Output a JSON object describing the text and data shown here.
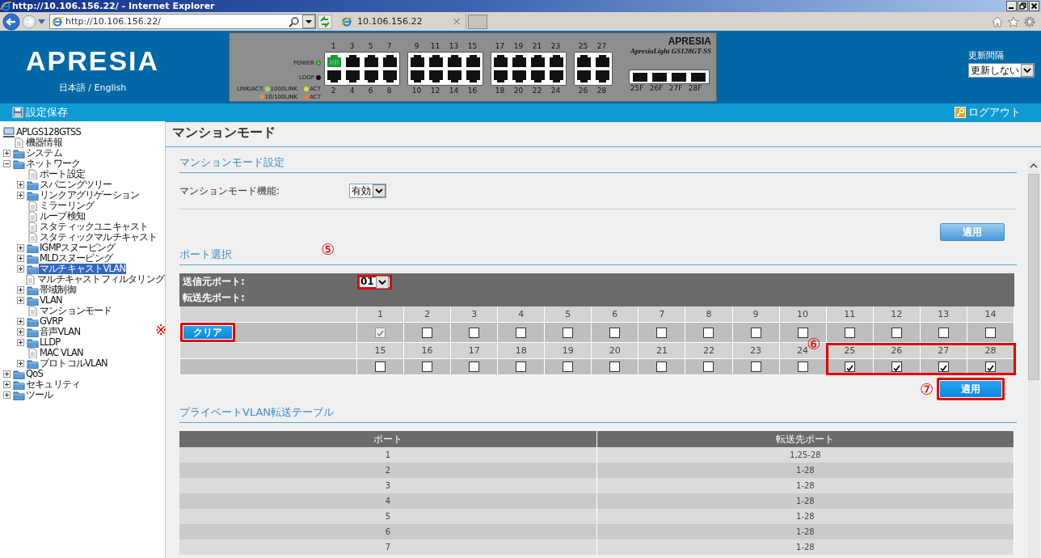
{
  "window": {
    "title": "http://10.106.156.22/ - Internet Explorer"
  },
  "browser": {
    "address": "http://10.106.156.22/",
    "tab": {
      "label": "10.106.156.22",
      "close": "×"
    }
  },
  "header": {
    "logo": "APRESIA",
    "language": "日本語 / English",
    "refresh": {
      "label": "更新間隔",
      "value": "更新しない"
    }
  },
  "switch_panel": {
    "brand": "APRESIA",
    "model": "ApresiaLight GS128GT-SS",
    "indicators": [
      {
        "label": "POWER",
        "on": true
      },
      {
        "label": "LOOP",
        "on": false
      }
    ],
    "legend_title": "LINK/ACT:",
    "legend": [
      {
        "label": "1000LINK",
        "color": "#9be25a"
      },
      {
        "label": "ACT",
        "color": "#c8e83c"
      },
      {
        "label": "10/100LINK",
        "color": "#f08a4a"
      },
      {
        "label": "ACT",
        "color": "#f07a3a"
      }
    ],
    "port_groups": [
      [
        {
          "top": {
            "label": "1",
            "link": true
          },
          "bottom": {
            "label": "2",
            "link": false
          }
        },
        {
          "top": {
            "label": "3",
            "link": false
          },
          "bottom": {
            "label": "4",
            "link": false
          }
        },
        {
          "top": {
            "label": "5",
            "link": false
          },
          "bottom": {
            "label": "6",
            "link": false
          }
        },
        {
          "top": {
            "label": "7",
            "link": false
          },
          "bottom": {
            "label": "8",
            "link": false
          }
        }
      ],
      [
        {
          "top": {
            "label": "9",
            "link": false
          },
          "bottom": {
            "label": "10",
            "link": false
          }
        },
        {
          "top": {
            "label": "11",
            "link": false
          },
          "bottom": {
            "label": "12",
            "link": false
          }
        },
        {
          "top": {
            "label": "13",
            "link": false
          },
          "bottom": {
            "label": "14",
            "link": false
          }
        },
        {
          "top": {
            "label": "15",
            "link": false
          },
          "bottom": {
            "label": "16",
            "link": false
          }
        }
      ],
      [
        {
          "top": {
            "label": "17",
            "link": false
          },
          "bottom": {
            "label": "18",
            "link": false
          }
        },
        {
          "top": {
            "label": "19",
            "link": false
          },
          "bottom": {
            "label": "20",
            "link": false
          }
        },
        {
          "top": {
            "label": "21",
            "link": false
          },
          "bottom": {
            "label": "22",
            "link": false
          }
        },
        {
          "top": {
            "label": "23",
            "link": false
          },
          "bottom": {
            "label": "24",
            "link": false
          }
        }
      ],
      [
        {
          "top": {
            "label": "25",
            "link": false
          },
          "bottom": {
            "label": "26",
            "link": false
          }
        },
        {
          "top": {
            "label": "27",
            "link": false
          },
          "bottom": {
            "label": "28",
            "link": false
          }
        }
      ]
    ],
    "sfp": [
      {
        "label": "25F"
      },
      {
        "label": "26F"
      },
      {
        "label": "27F"
      },
      {
        "label": "28F"
      }
    ]
  },
  "toolbar": {
    "save": "設定保存",
    "logout": "ログアウト"
  },
  "sidebar": {
    "root": {
      "label": "APLGS128GTSS",
      "kind": "device",
      "selected": false,
      "children": [
        {
          "label": "機器情報",
          "kind": "page",
          "selected": false
        },
        {
          "label": "システム",
          "kind": "folder",
          "expanded": false,
          "selected": false
        },
        {
          "label": "ネットワーク",
          "kind": "folder",
          "expanded": true,
          "selected": false,
          "children": [
            {
              "label": "ポート設定",
              "kind": "page",
              "selected": false
            },
            {
              "label": "スパニングツリー",
              "kind": "folder",
              "expanded": false,
              "selected": false
            },
            {
              "label": "リンクアグリゲーション",
              "kind": "folder",
              "expanded": false,
              "selected": false
            },
            {
              "label": "ミラーリング",
              "kind": "page",
              "selected": false
            },
            {
              "label": "ループ検知",
              "kind": "page",
              "selected": false
            },
            {
              "label": "スタティックユニキャスト",
              "kind": "page",
              "selected": false
            },
            {
              "label": "スタティックマルチキャスト",
              "kind": "page",
              "selected": false
            },
            {
              "label": "IGMPスヌーピング",
              "kind": "folder",
              "expanded": false,
              "selected": false
            },
            {
              "label": "MLDスヌーピング",
              "kind": "folder",
              "expanded": false,
              "selected": false
            },
            {
              "label": "マルチキャストVLAN",
              "kind": "folder",
              "expanded": false,
              "selected": true
            },
            {
              "label": "マルチキャストフィルタリング",
              "kind": "page",
              "selected": false
            },
            {
              "label": "帯域制御",
              "kind": "folder",
              "expanded": false,
              "selected": false
            },
            {
              "label": "VLAN",
              "kind": "folder",
              "expanded": false,
              "selected": false
            },
            {
              "label": "マンションモード",
              "kind": "page",
              "selected": false
            },
            {
              "label": "GVRP",
              "kind": "folder",
              "expanded": false,
              "selected": false
            },
            {
              "label": "音声VLAN",
              "kind": "folder",
              "expanded": false,
              "selected": false
            },
            {
              "label": "LLDP",
              "kind": "folder",
              "expanded": false,
              "selected": false
            },
            {
              "label": "MAC VLAN",
              "kind": "page",
              "selected": false
            },
            {
              "label": "プロトコルVLAN",
              "kind": "folder",
              "expanded": false,
              "selected": false
            }
          ]
        },
        {
          "label": "QoS",
          "kind": "folder",
          "expanded": false,
          "selected": false
        },
        {
          "label": "セキュリティ",
          "kind": "folder",
          "expanded": false,
          "selected": false
        },
        {
          "label": "ツール",
          "kind": "folder",
          "expanded": false,
          "selected": false
        }
      ]
    }
  },
  "main": {
    "title": "マンションモード",
    "mansion_settings": {
      "heading": "マンションモード設定",
      "field_label": "マンションモード機能:",
      "value": "有効",
      "apply": "適用"
    },
    "port_select": {
      "heading": "ポート選択",
      "source_label": "送信元ポート:",
      "source_value": "01",
      "source_highlighted": true,
      "dest_label": "転送先ポート:",
      "clear": {
        "label": "クリア",
        "highlighted": true
      },
      "ports": [
        {
          "label": "1",
          "checked": true,
          "disabled": true,
          "highlighted": false
        },
        {
          "label": "2",
          "checked": false,
          "disabled": false,
          "highlighted": false
        },
        {
          "label": "3",
          "checked": false,
          "disabled": false,
          "highlighted": false
        },
        {
          "label": "4",
          "checked": false,
          "disabled": false,
          "highlighted": false
        },
        {
          "label": "5",
          "checked": false,
          "disabled": false,
          "highlighted": false
        },
        {
          "label": "6",
          "checked": false,
          "disabled": false,
          "highlighted": false
        },
        {
          "label": "7",
          "checked": false,
          "disabled": false,
          "highlighted": false
        },
        {
          "label": "8",
          "checked": false,
          "disabled": false,
          "highlighted": false
        },
        {
          "label": "9",
          "checked": false,
          "disabled": false,
          "highlighted": false
        },
        {
          "label": "10",
          "checked": false,
          "disabled": false,
          "highlighted": false
        },
        {
          "label": "11",
          "checked": false,
          "disabled": false,
          "highlighted": false
        },
        {
          "label": "12",
          "checked": false,
          "disabled": false,
          "highlighted": false
        },
        {
          "label": "13",
          "checked": false,
          "disabled": false,
          "highlighted": false
        },
        {
          "label": "14",
          "checked": false,
          "disabled": false,
          "highlighted": false
        },
        {
          "label": "15",
          "checked": false,
          "disabled": false,
          "highlighted": false
        },
        {
          "label": "16",
          "checked": false,
          "disabled": false,
          "highlighted": false
        },
        {
          "label": "17",
          "checked": false,
          "disabled": false,
          "highlighted": false
        },
        {
          "label": "18",
          "checked": false,
          "disabled": false,
          "highlighted": false
        },
        {
          "label": "19",
          "checked": false,
          "disabled": false,
          "highlighted": false
        },
        {
          "label": "20",
          "checked": false,
          "disabled": false,
          "highlighted": false
        },
        {
          "label": "21",
          "checked": false,
          "disabled": false,
          "highlighted": false
        },
        {
          "label": "22",
          "checked": false,
          "disabled": false,
          "highlighted": false
        },
        {
          "label": "23",
          "checked": false,
          "disabled": false,
          "highlighted": false
        },
        {
          "label": "24",
          "checked": false,
          "disabled": false,
          "highlighted": false
        },
        {
          "label": "25",
          "checked": true,
          "disabled": false,
          "highlighted": true
        },
        {
          "label": "26",
          "checked": true,
          "disabled": false,
          "highlighted": true
        },
        {
          "label": "27",
          "checked": true,
          "disabled": false,
          "highlighted": true
        },
        {
          "label": "28",
          "checked": true,
          "disabled": false,
          "highlighted": true
        }
      ],
      "apply": {
        "label": "適用",
        "highlighted": true
      }
    },
    "annotations": {
      "source": "⑤",
      "ports": "⑥",
      "apply": "⑦",
      "clear": "※"
    },
    "forward_table": {
      "heading": "プライベートVLAN転送テーブル",
      "columns": [
        "ポート",
        "転送先ポート"
      ],
      "rows": [
        [
          "1",
          "1,25-28"
        ],
        [
          "2",
          "1-28"
        ],
        [
          "3",
          "1-28"
        ],
        [
          "4",
          "1-28"
        ],
        [
          "5",
          "1-28"
        ],
        [
          "6",
          "1-28"
        ],
        [
          "7",
          "1-28"
        ]
      ]
    }
  }
}
